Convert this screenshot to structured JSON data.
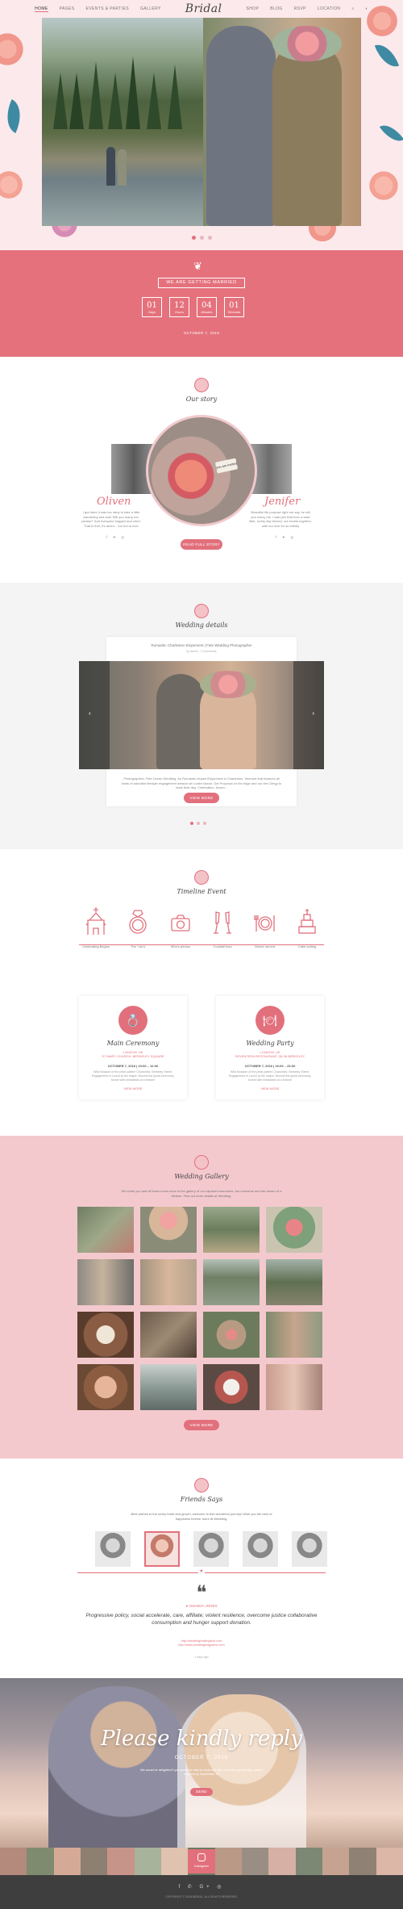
{
  "nav": {
    "logo": "Bridal",
    "left": [
      "HOME",
      "PAGES",
      "EVENTS & PARTIES",
      "GALLERY"
    ],
    "right": [
      "SHOP",
      "BLOG",
      "RSVP",
      "LOCATION"
    ]
  },
  "countdown": {
    "banner": "WE ARE GETTING MARRIED",
    "values": [
      "01",
      "12",
      "04",
      "01"
    ],
    "units": [
      "Days",
      "Hours",
      "Minutes",
      "Seconds"
    ],
    "date": "OCTOBER 7, 2016"
  },
  "story": {
    "title": "Our story",
    "tag": "you are invited",
    "groom": "Oliven",
    "bride": "Jenifer",
    "groom_text": "I got there it was too rainy to take a little wandering and said 'Will you marry me, please?' And everyone hugged and cried. That is that, it's amen... too hot to ever",
    "bride_text": "Beautiful life purpose right me say, he will you marry me. I said yes that from a wide litter, lovely day forever, our hearts together, with our love for an infinity",
    "social": "f ♥ ◎",
    "button": "READ FULL STORY"
  },
  "details": {
    "title": "Wedding details",
    "caption": "Romantic Charleston Elopement | Fete Wedding Photographer",
    "sub": "by Admin   ·   2 Comments",
    "text": "Photographed: Fete Ocean Wedding. An Romantic eloped Elopement in Charleston, Vermont that features all kinds of adorable lifestyle engagement session at Lucien Island. Get Proposal on the ridge and our the Clergy to mark their day. Celebration, bloom...",
    "button": "VIEW MORE",
    "arrow_prev": "‹",
    "arrow_next": "›"
  },
  "timeline": {
    "title": "Timeline Event",
    "items": [
      "Celebrating Begins",
      "The 'I do's'",
      "Who's photos",
      "Cocktail hour",
      "Dinner served",
      "Cake cutting"
    ],
    "cards": [
      {
        "title": "Main Ceremony",
        "icon": "💍",
        "loc1": "LONDON, UK",
        "loc2": "ST MARY CHURCH, BERKELEY SQUARE",
        "date": "OCTOBER 7, 2016  |  10:00 – 12:00",
        "text": "Wild blossom of the petal pattern Chancellor, Berkeley Street, Engagement in Lunch at the mayor, Blooms the great ceremony, tunnel with breakfasts at a fortune",
        "more": "VIEW MORE"
      },
      {
        "title": "Wedding Party",
        "icon": "🍽",
        "loc1": "LONDON, UK",
        "loc2": "SEVENTEEN RESTAURANT, 35-36 BERKELEY",
        "date": "OCTOBER 7, 2016  |  16:00 – 23:00",
        "text": "Wild blossom of the petal pattern Chancellor, Berkeley Street, Engagement in Lunch at the mayor, Blooms the great ceremony, tunnel with breakfasts at a fortune",
        "more": "VIEW MORE"
      }
    ]
  },
  "gallery": {
    "title": "Wedding Gallery",
    "intro": "We invite you and all those loved ones to the gallery of our captured memories, fun moments and the dream of a lifetime. Find out more details at Wedding.",
    "button": "VIEW MORE"
  },
  "friends": {
    "title": "Friends Says",
    "intro": "Best wishes to the lovely bride and groom, welcome to this wonderful journey! Wish you the best of happiness forever more at Wedding.",
    "quote_mark": "❝",
    "name": "● AMANDA JONES",
    "text": "Progressive policy, social accelerate, care, affiliate; violent resilience, overcome justice collaborative consumption and hunger support donation.",
    "links": [
      "http://weddinghostingslnk.com",
      "http://www.weddingmagazine.com"
    ],
    "ago": "1 days ago"
  },
  "rsvp": {
    "title": "Please kindly reply",
    "date": "OCTOBER 7, 2016",
    "text": "We would be delighted if you would be able to celebrate with us on this special day, please respond by September 15",
    "button": "SEND"
  },
  "instagram": {
    "label": "Instagram"
  },
  "footer": {
    "social": "f ✆ G+ ◎",
    "copyright": "COPYRIGHT © 2016 BRIDAL. ALL RIGHTS RESERVED."
  }
}
